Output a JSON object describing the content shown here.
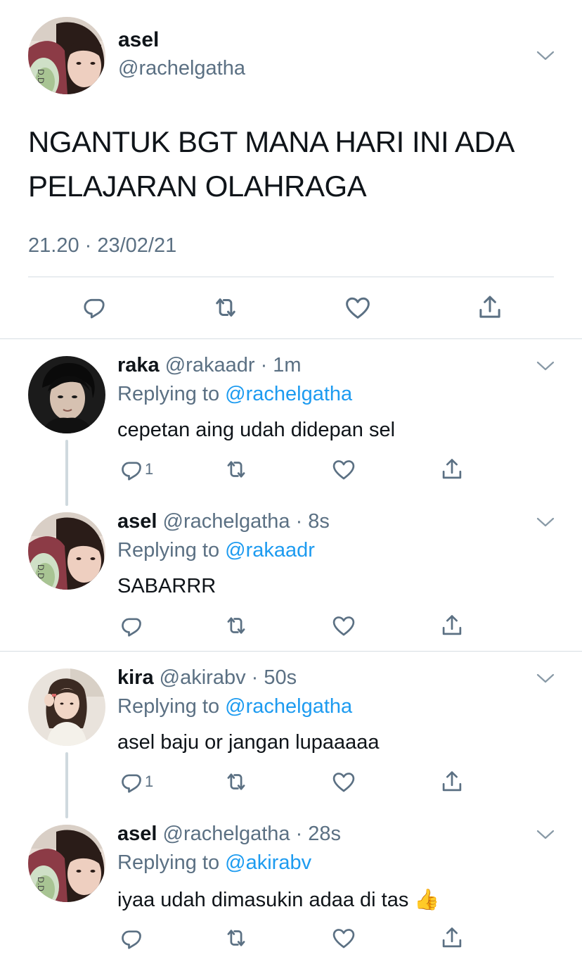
{
  "main_tweet": {
    "name": "asel",
    "handle": "@rachelgatha",
    "text": "NGANTUK BGT MANA HARI INI ADA PELAJARAN OLAHRAGA",
    "timestamp": "21.20 · 23/02/21",
    "icons": [
      "chevron-down-icon",
      "reply-icon",
      "retweet-icon",
      "like-icon",
      "share-icon"
    ]
  },
  "replies": [
    {
      "name": "raka",
      "handle": "@rakaadr",
      "time": "1m",
      "replying_label": "Replying to",
      "replying_to": "@rachelgatha",
      "text": "cepetan aing udah didepan sel",
      "reply_count": "1"
    },
    {
      "name": "asel",
      "handle": "@rachelgatha",
      "time": "8s",
      "replying_label": "Replying to",
      "replying_to": "@rakaadr",
      "text": "SABARRR",
      "reply_count": ""
    },
    {
      "name": "kira",
      "handle": "@akirabv",
      "time": "50s",
      "replying_label": "Replying to",
      "replying_to": "@rachelgatha",
      "text": "asel baju or jangan lupaaaaa",
      "reply_count": "1"
    },
    {
      "name": "asel",
      "handle": "@rachelgatha",
      "time": "28s",
      "replying_label": "Replying to",
      "replying_to": "@akirabv",
      "text": "iyaa udah dimasukin adaa di tas",
      "emoji": "👍",
      "reply_count": ""
    }
  ],
  "colors": {
    "text": "#0f1419",
    "secondary": "#5b7083",
    "link": "#1d9bf0",
    "divider": "#d6dde3",
    "thread_line": "#cfd9de"
  }
}
